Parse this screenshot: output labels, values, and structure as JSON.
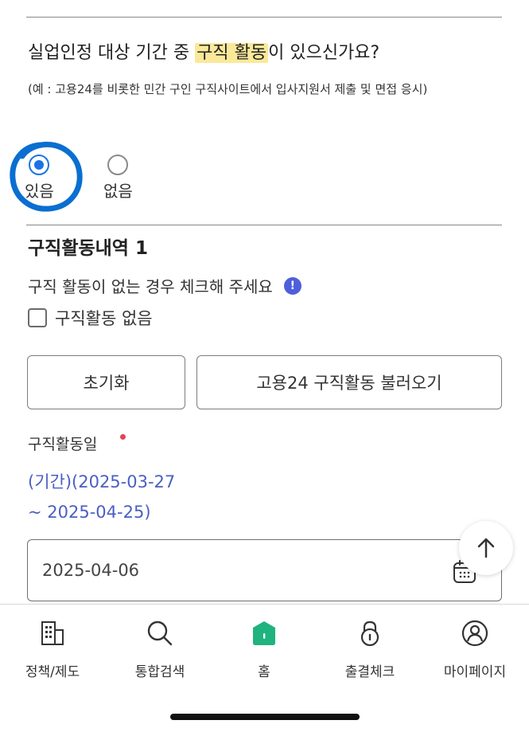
{
  "question": {
    "title_before": "실업인정 대상 기간 중 ",
    "title_highlight": "구직 활동",
    "title_after": "이 있으신가요?",
    "subtitle": "(예 : 고용24를 비롯한 민간 구인 구직사이트에서 입사지원서 제출 및 면접 응시)"
  },
  "options": {
    "yes_label": "있음",
    "no_label": "없음",
    "selected": "yes"
  },
  "history": {
    "title": "구직활동내역 1",
    "hint": "구직 활동이 없는 경우 체크해 주세요",
    "info_glyph": "!",
    "checkbox_label": "구직활동 없음",
    "checkbox_checked": false
  },
  "buttons": {
    "reset": "초기화",
    "load": "고용24 구직활동 불러오기"
  },
  "activity_date": {
    "label": "구직활동일",
    "period_line1": "(기간)(2025-03-27",
    "period_line2": "~ 2025-04-25)",
    "value": "2025-04-06"
  },
  "nav": {
    "items": [
      {
        "label": "정책/제도",
        "icon": "building-icon"
      },
      {
        "label": "통합검색",
        "icon": "search-icon"
      },
      {
        "label": "홈",
        "icon": "home-icon"
      },
      {
        "label": "출결체크",
        "icon": "lock-icon"
      },
      {
        "label": "마이페이지",
        "icon": "user-icon"
      }
    ]
  },
  "colors": {
    "accent_blue": "#1a73e8",
    "period_text": "#4a5fc1",
    "highlight": "#fbe99a",
    "home_green": "#1fb37e",
    "required_dot": "#e0445a"
  }
}
